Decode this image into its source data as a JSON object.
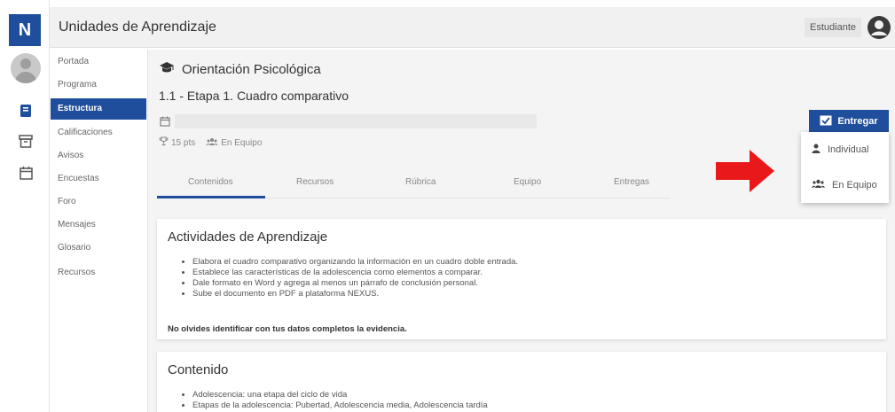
{
  "app": {
    "logo_letter": "N",
    "title": "Unidades de Aprendizaje"
  },
  "user": {
    "role": "Estudiante"
  },
  "nav": {
    "items": [
      {
        "label": "Portada"
      },
      {
        "label": "Programa"
      },
      {
        "label": "Estructura",
        "active": true
      },
      {
        "label": "Calificaciones"
      },
      {
        "label": "Avisos"
      },
      {
        "label": "Encuestas"
      },
      {
        "label": "Foro"
      },
      {
        "label": "Mensajes"
      },
      {
        "label": "Glosario"
      },
      {
        "label": "Recursos"
      }
    ]
  },
  "rail": {
    "icons": [
      "book-icon",
      "archive-icon",
      "calendar-icon"
    ]
  },
  "course": {
    "icon": "graduation-cap-icon",
    "title": "Orientación Psicológica"
  },
  "activity": {
    "title": "1.1 - Etapa 1. Cuadro comparativo",
    "points": "15 pts",
    "mode": "En Equipo"
  },
  "tabs": [
    "Contenidos",
    "Recursos",
    "Rúbrica",
    "Equipo",
    "Entregas"
  ],
  "active_tab": "Contenidos",
  "submit": {
    "label": "Entregar",
    "options": [
      "Individual",
      "En Equipo"
    ]
  },
  "colors": {
    "primary": "#1f4e9c",
    "arrow": "#e8181b"
  },
  "sections": {
    "activities": {
      "heading": "Actividades de Aprendizaje",
      "bullets": [
        "Elabora el cuadro comparativo organizando la información en un cuadro doble entrada.",
        "Establece las características de la adolescencia como elementos a comparar.",
        "Dale formato en Word y agrega al menos un párrafo de conclusión personal.",
        "Sube el documento en PDF a plataforma NEXUS."
      ],
      "note": "No olvides identificar con tus datos completos la evidencia."
    },
    "content": {
      "heading": "Contenido",
      "bullets": [
        "Adolescencia: una etapa del ciclo de vida",
        "Etapas de la adolescencia: Pubertad, Adolescencia media, Adolescencia tardía"
      ]
    }
  }
}
